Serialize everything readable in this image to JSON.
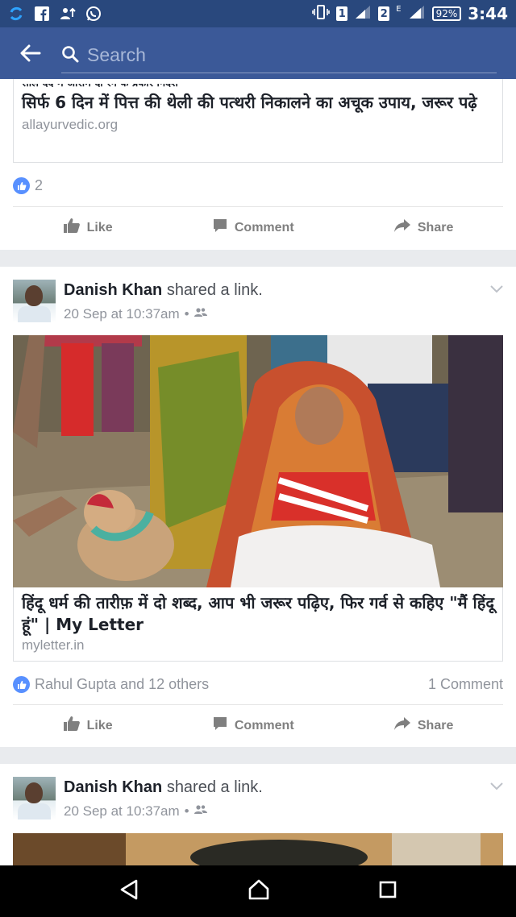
{
  "status_bar": {
    "battery": "92%",
    "time": "3:44",
    "sim1": "1",
    "sim2": "2",
    "network": "E"
  },
  "app_bar": {
    "search_placeholder": "Search"
  },
  "post1": {
    "clipped_line": "साल दर्द में आराम दो रंग के प्रकार निर्देश",
    "link_title": "सिर्फ 6 दिन में पित्त की थेली की पत्थरी निकालने का अचूक उपाय, जरूर पढ़े",
    "link_domain": "allayurvedic.org",
    "like_count": "2",
    "actions": {
      "like": "Like",
      "comment": "Comment",
      "share": "Share"
    }
  },
  "post2": {
    "author": "Danish Khan",
    "verb": "shared a link.",
    "timestamp": "20 Sep at 10:37am",
    "audience_sep": "•",
    "link_title": "हिंदू धर्म की तारीफ़ में दो शब्द, आप भी जरूर पढ़िए, फिर गर्व से कहिए \"मैं हिंदू हूं\" | My Letter",
    "link_domain": "myletter.in",
    "reactions_text": "Rahul Gupta and 12 others",
    "comment_count": "1 Comment",
    "actions": {
      "like": "Like",
      "comment": "Comment",
      "share": "Share"
    }
  },
  "post3": {
    "author": "Danish Khan",
    "verb": "shared a link.",
    "timestamp": "20 Sep at 10:37am",
    "audience_sep": "•"
  },
  "colors": {
    "facebook_blue": "#3b5998",
    "status_bar": "#29487d",
    "like_blue": "#5890ff",
    "feed_bg": "#e9ebee"
  },
  "icons": {
    "status_left": [
      "sync-icon",
      "facebook-icon",
      "person-up-icon",
      "whatsapp-icon"
    ],
    "status_right": [
      "vibrate-icon",
      "signal-icon",
      "battery-icon"
    ],
    "nav": [
      "back-triangle-icon",
      "home-icon",
      "recents-icon"
    ]
  }
}
